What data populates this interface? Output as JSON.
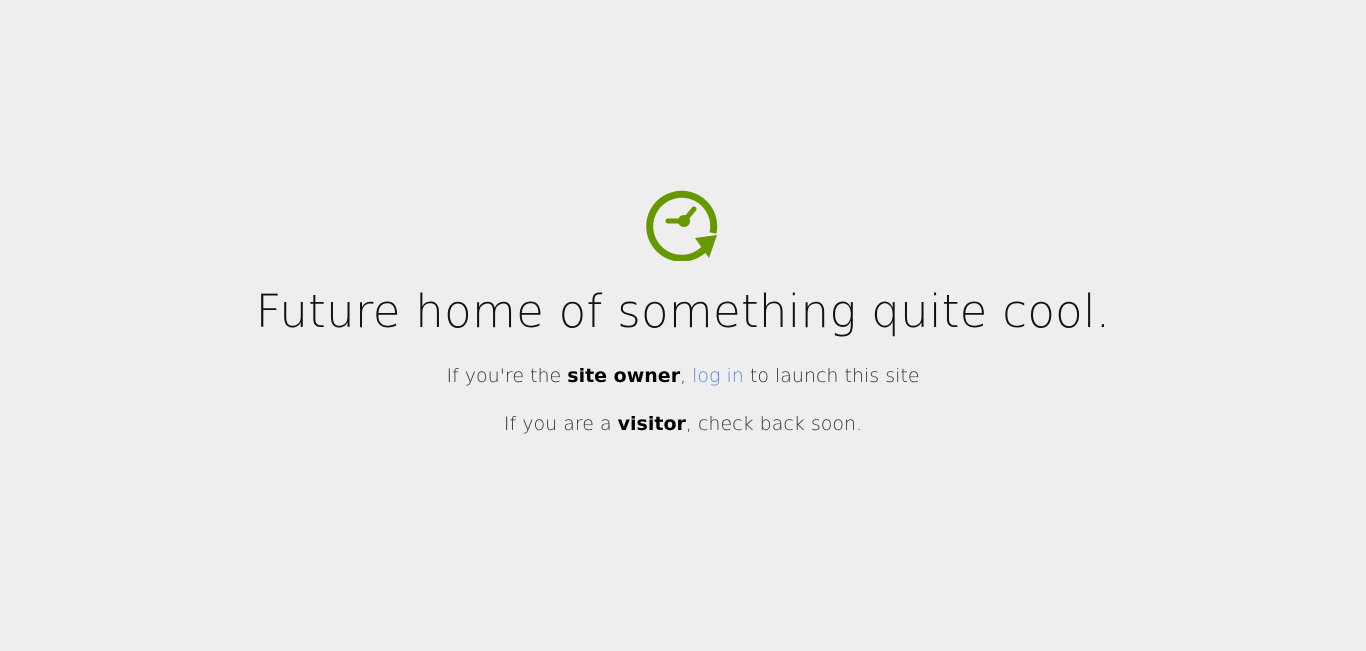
{
  "brand_color": "#669900",
  "link_color": "#5b86e0",
  "logo": {
    "icon": "clock-refresh-icon"
  },
  "headline": "Future home of something quite cool.",
  "owner_line": {
    "prefix": "If you're the ",
    "emphasis": "site owner",
    "comma": ", ",
    "link_text": "log in",
    "suffix": " to launch this site"
  },
  "visitor_line": {
    "prefix": "If you are a ",
    "emphasis": "visitor",
    "suffix": ", check back soon."
  }
}
